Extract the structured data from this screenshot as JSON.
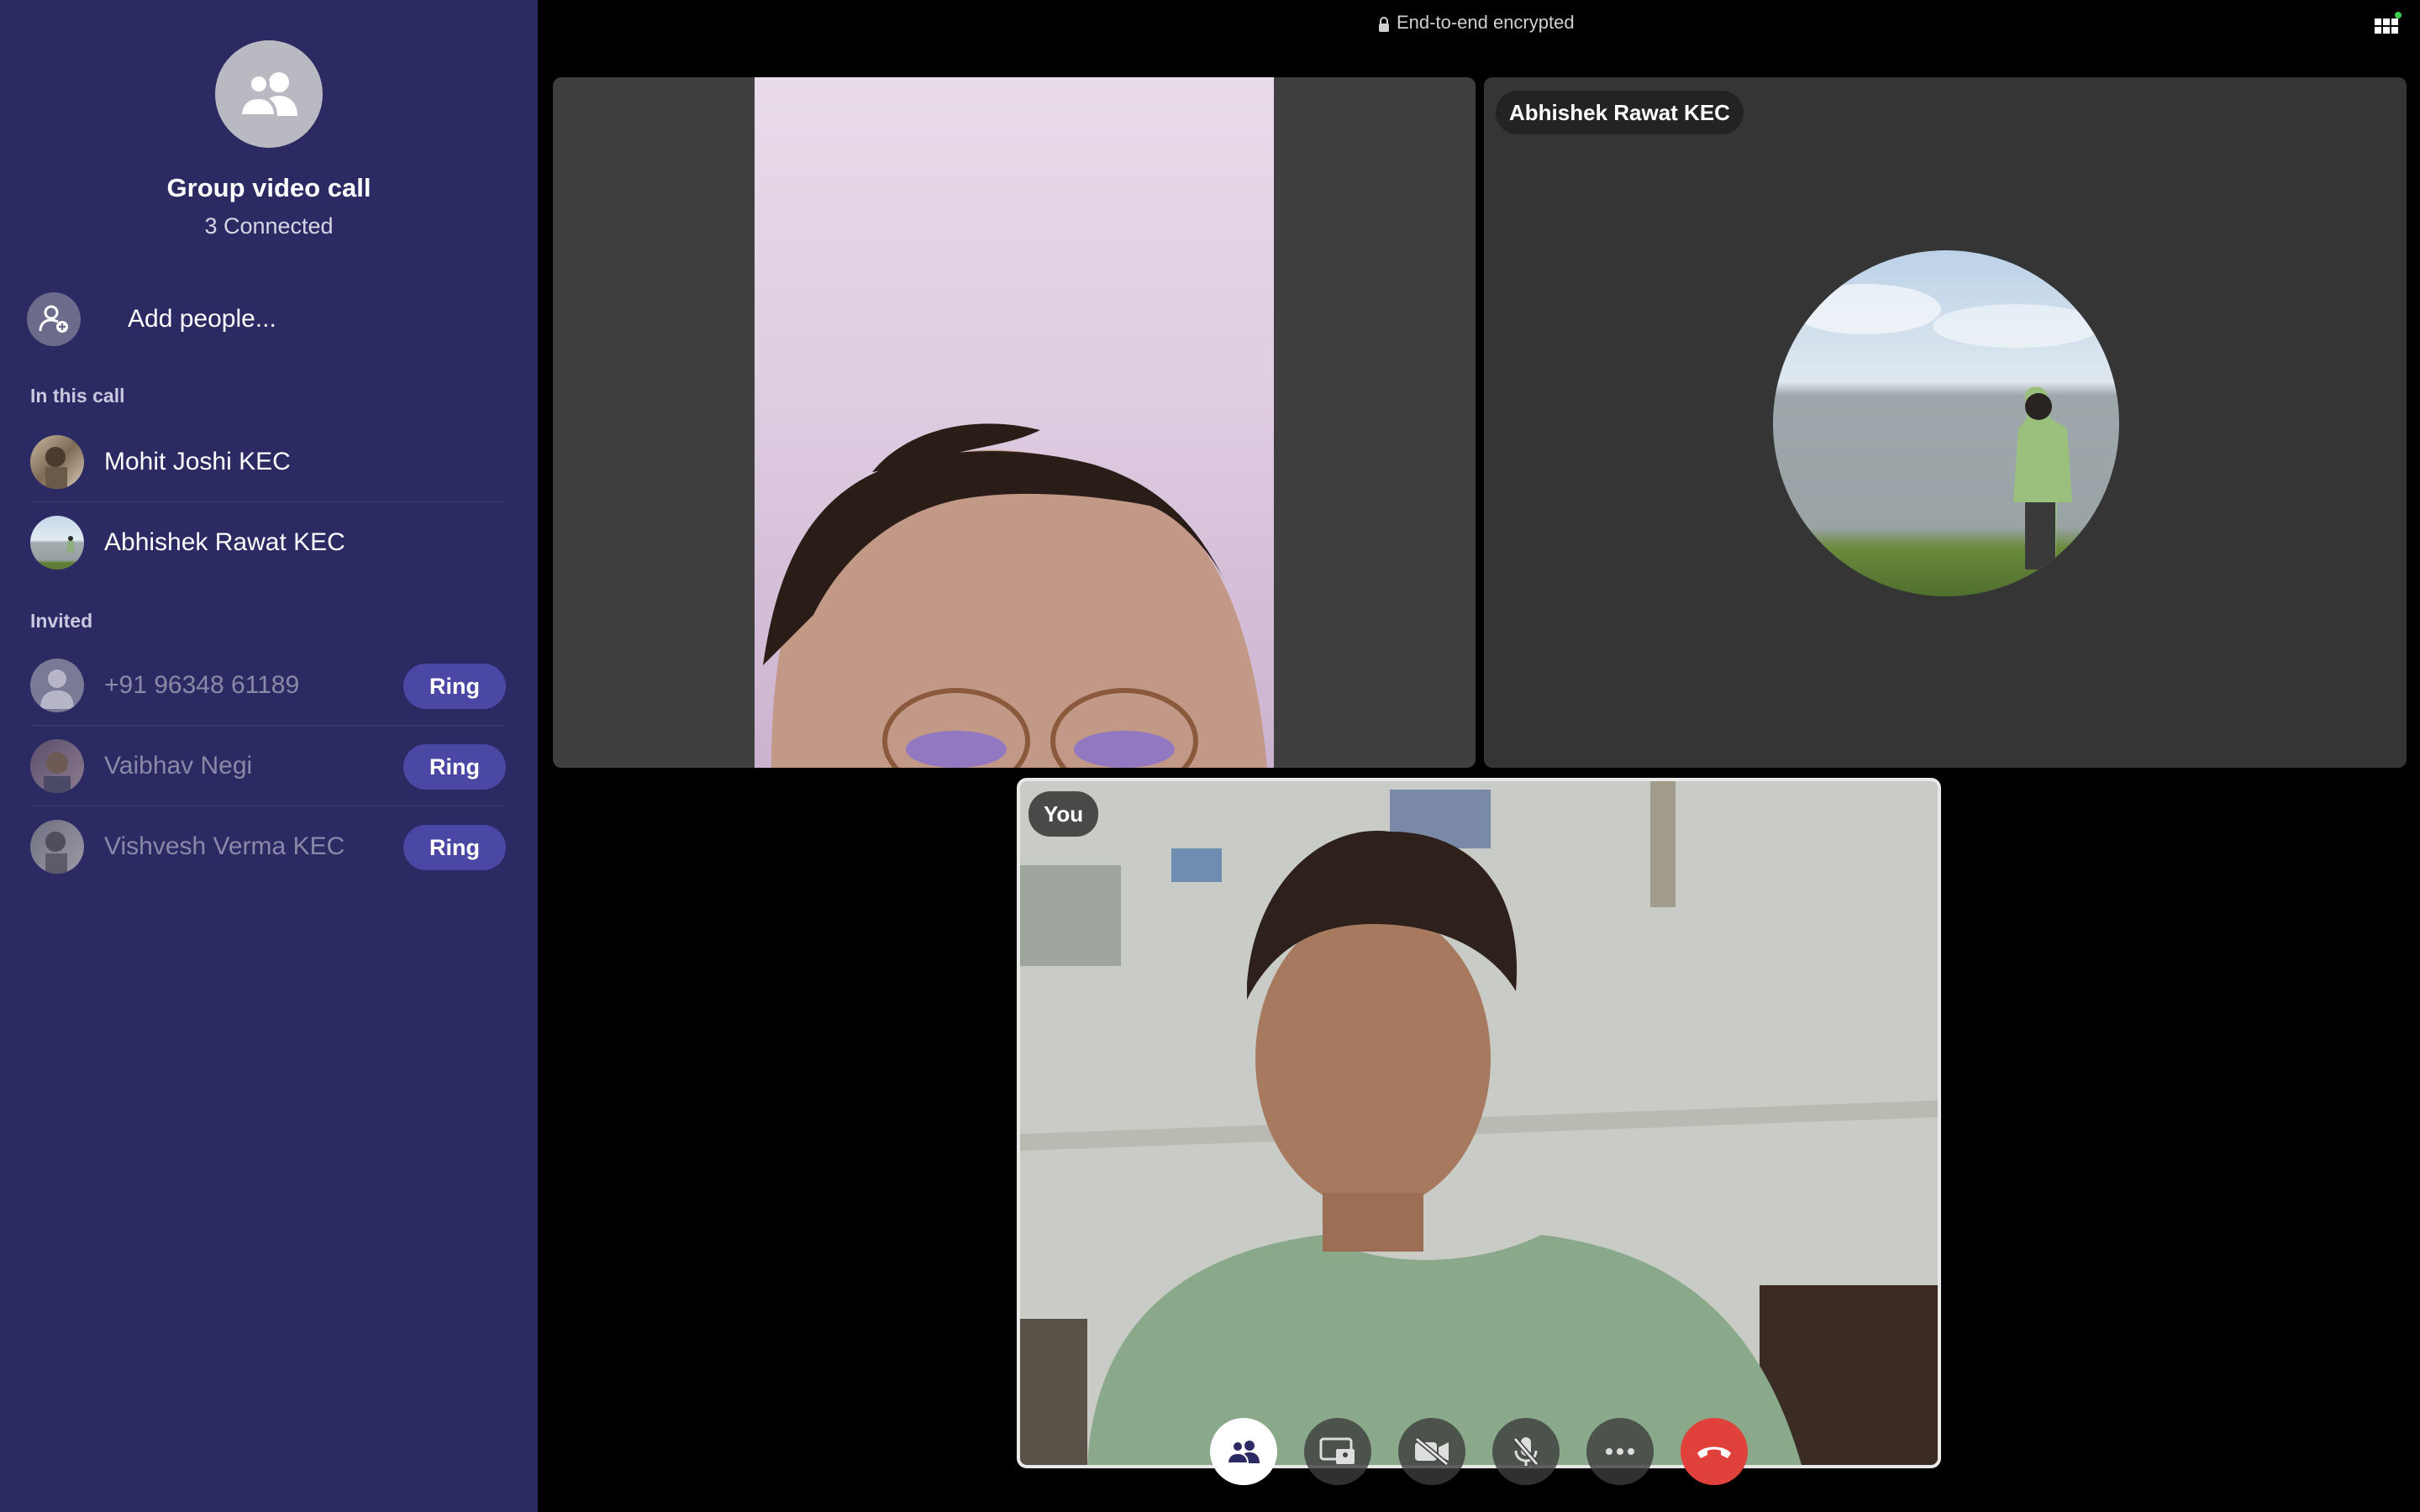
{
  "sidebar": {
    "title": "Group video call",
    "subtitle": "3 Connected",
    "add_people": "Add people...",
    "in_call_label": "In this call",
    "in_call": [
      {
        "name": "Mohit Joshi KEC"
      },
      {
        "name": "Abhishek Rawat KEC"
      }
    ],
    "invited_label": "Invited",
    "invited": [
      {
        "name": "+91 96348 61189",
        "action": "Ring"
      },
      {
        "name": "Vaibhav Negi",
        "action": "Ring"
      },
      {
        "name": "Vishvesh Verma KEC",
        "action": "Ring"
      }
    ]
  },
  "topbar": {
    "encryption": "End-to-end encrypted"
  },
  "tiles": {
    "remote_2_name": "Abhishek Rawat KEC",
    "self_name": "You"
  },
  "controls": [
    {
      "icon": "people-icon"
    },
    {
      "icon": "screen-share-icon"
    },
    {
      "icon": "camera-off-icon"
    },
    {
      "icon": "mic-off-icon"
    },
    {
      "icon": "more-icon"
    },
    {
      "icon": "end-call-icon"
    }
  ],
  "colors": {
    "sidebar_bg": "#2b2a63",
    "ring_button": "#4b48a5",
    "end_call": "#e0413b"
  }
}
